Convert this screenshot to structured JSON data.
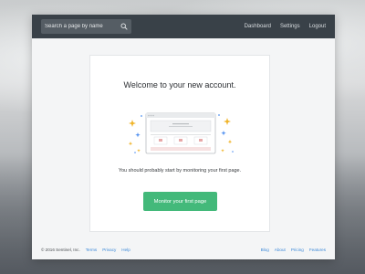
{
  "nav": {
    "search_placeholder": "Search a page by name",
    "links": [
      "Dashboard",
      "Settings",
      "Logout"
    ]
  },
  "card": {
    "title": "Welcome to your new account.",
    "text": "You should probably start by monitoring your first page.",
    "button_label": "Monitor your first page"
  },
  "footer": {
    "copyright": "© 2016 Sentinel, Inc.",
    "left_links": [
      "Terms",
      "Privacy",
      "Help"
    ],
    "right_links": [
      "Blog",
      "About",
      "Pricing",
      "Features"
    ]
  },
  "colors": {
    "navbar": "#394148",
    "accent_green": "#43b97a",
    "link_blue": "#3b88d8",
    "sparkle_yellow": "#f0b429",
    "sparkle_blue": "#4f8ff0",
    "mock_accent": "#e7a8a8"
  },
  "icons": {
    "search": "search-icon"
  }
}
